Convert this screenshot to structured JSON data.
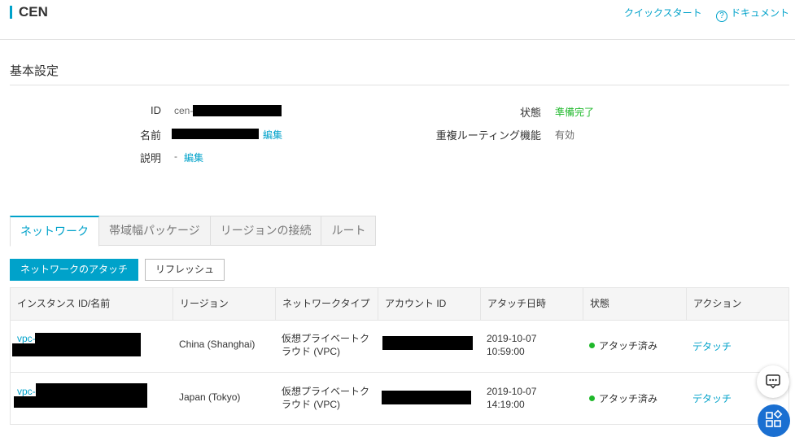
{
  "header": {
    "title": "CEN",
    "quickstart": "クイックスタート",
    "docs": "ドキュメント",
    "help_glyph": "?"
  },
  "basic": {
    "section_title": "基本設定",
    "id_label": "ID",
    "id_prefix": "cen-",
    "name_label": "名前",
    "edit": "編集",
    "desc_label": "説明",
    "desc_value": "-",
    "status_label": "状態",
    "status_value": "準備完了",
    "routing_label": "重複ルーティング機能",
    "routing_value": "有効"
  },
  "tabs": [
    "ネットワーク",
    "帯域幅パッケージ",
    "リージョンの接続",
    "ルート"
  ],
  "toolbar": {
    "attach": "ネットワークのアタッチ",
    "refresh": "リフレッシュ"
  },
  "table": {
    "columns": [
      "インスタンス ID/名前",
      "リージョン",
      "ネットワークタイプ",
      "アカウント ID",
      "アタッチ日時",
      "状態",
      "アクション"
    ],
    "rows": [
      {
        "id_prefix": "vpc-",
        "region": "China (Shanghai)",
        "type_line1": "仮想プライベートク",
        "type_line2": "ラウド (VPC)",
        "date": "2019-10-07",
        "time": "10:59:00",
        "status": "アタッチ済み",
        "action": "デタッチ"
      },
      {
        "id_prefix": "vpc-",
        "region": "Japan (Tokyo)",
        "type_line1": "仮想プライベートク",
        "type_line2": "ラウド (VPC)",
        "date": "2019-10-07",
        "time": "14:19:00",
        "status": "アタッチ済み",
        "action": "デタッチ"
      }
    ]
  },
  "colors": {
    "accent": "#00a2ca",
    "success": "#1fb82b",
    "fab": "#1a6fd1"
  }
}
